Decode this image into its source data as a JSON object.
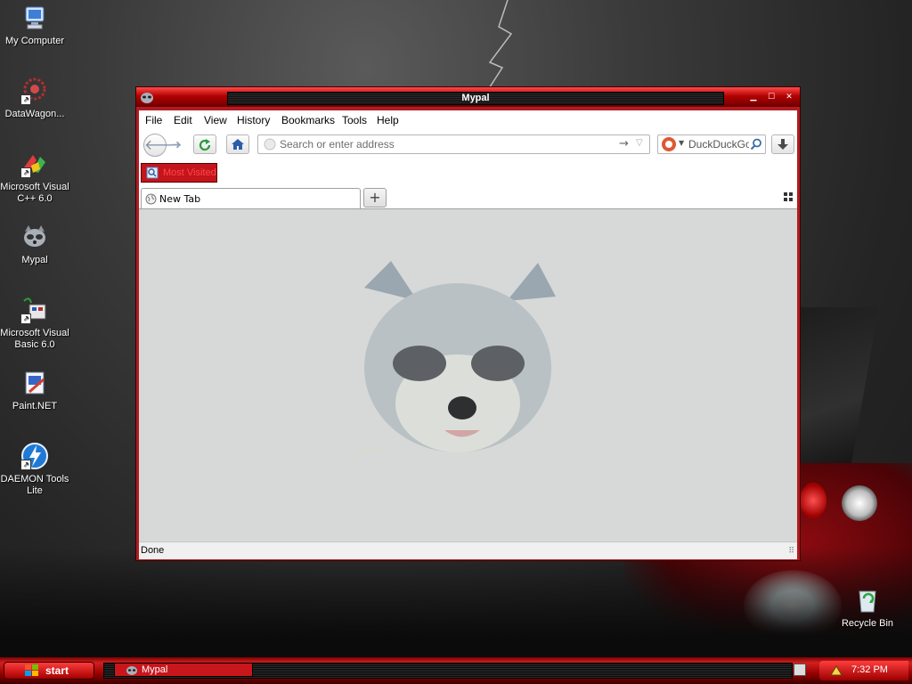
{
  "desktop": {
    "icons": [
      {
        "label": "My Computer"
      },
      {
        "label": "DataWagon..."
      },
      {
        "label": "Microsoft Visual C++ 6.0"
      },
      {
        "label": "Mypal"
      },
      {
        "label": "Microsoft Visual Basic 6.0"
      },
      {
        "label": "Paint.NET"
      },
      {
        "label": "DAEMON Tools Lite"
      },
      {
        "label": "Recycle Bin"
      }
    ]
  },
  "window": {
    "title": "Mypal",
    "controls": {
      "minimize": "▁",
      "maximize": "☐",
      "close": "✕"
    }
  },
  "browser": {
    "menu": [
      "File",
      "Edit",
      "View",
      "History",
      "Bookmarks",
      "Tools",
      "Help"
    ],
    "address_placeholder": "Search or enter address",
    "search_engine": "DuckDuckGo",
    "bookmark_label": "Most Visited",
    "tab_label": "New Tab",
    "status": "Done"
  },
  "taskbar": {
    "start_label": "start",
    "task_label": "Mypal",
    "clock": "7:32 PM"
  },
  "colors": {
    "accent": "#c4141c",
    "titlebar": "#b20000",
    "page_bg": "#d7d9d8"
  }
}
